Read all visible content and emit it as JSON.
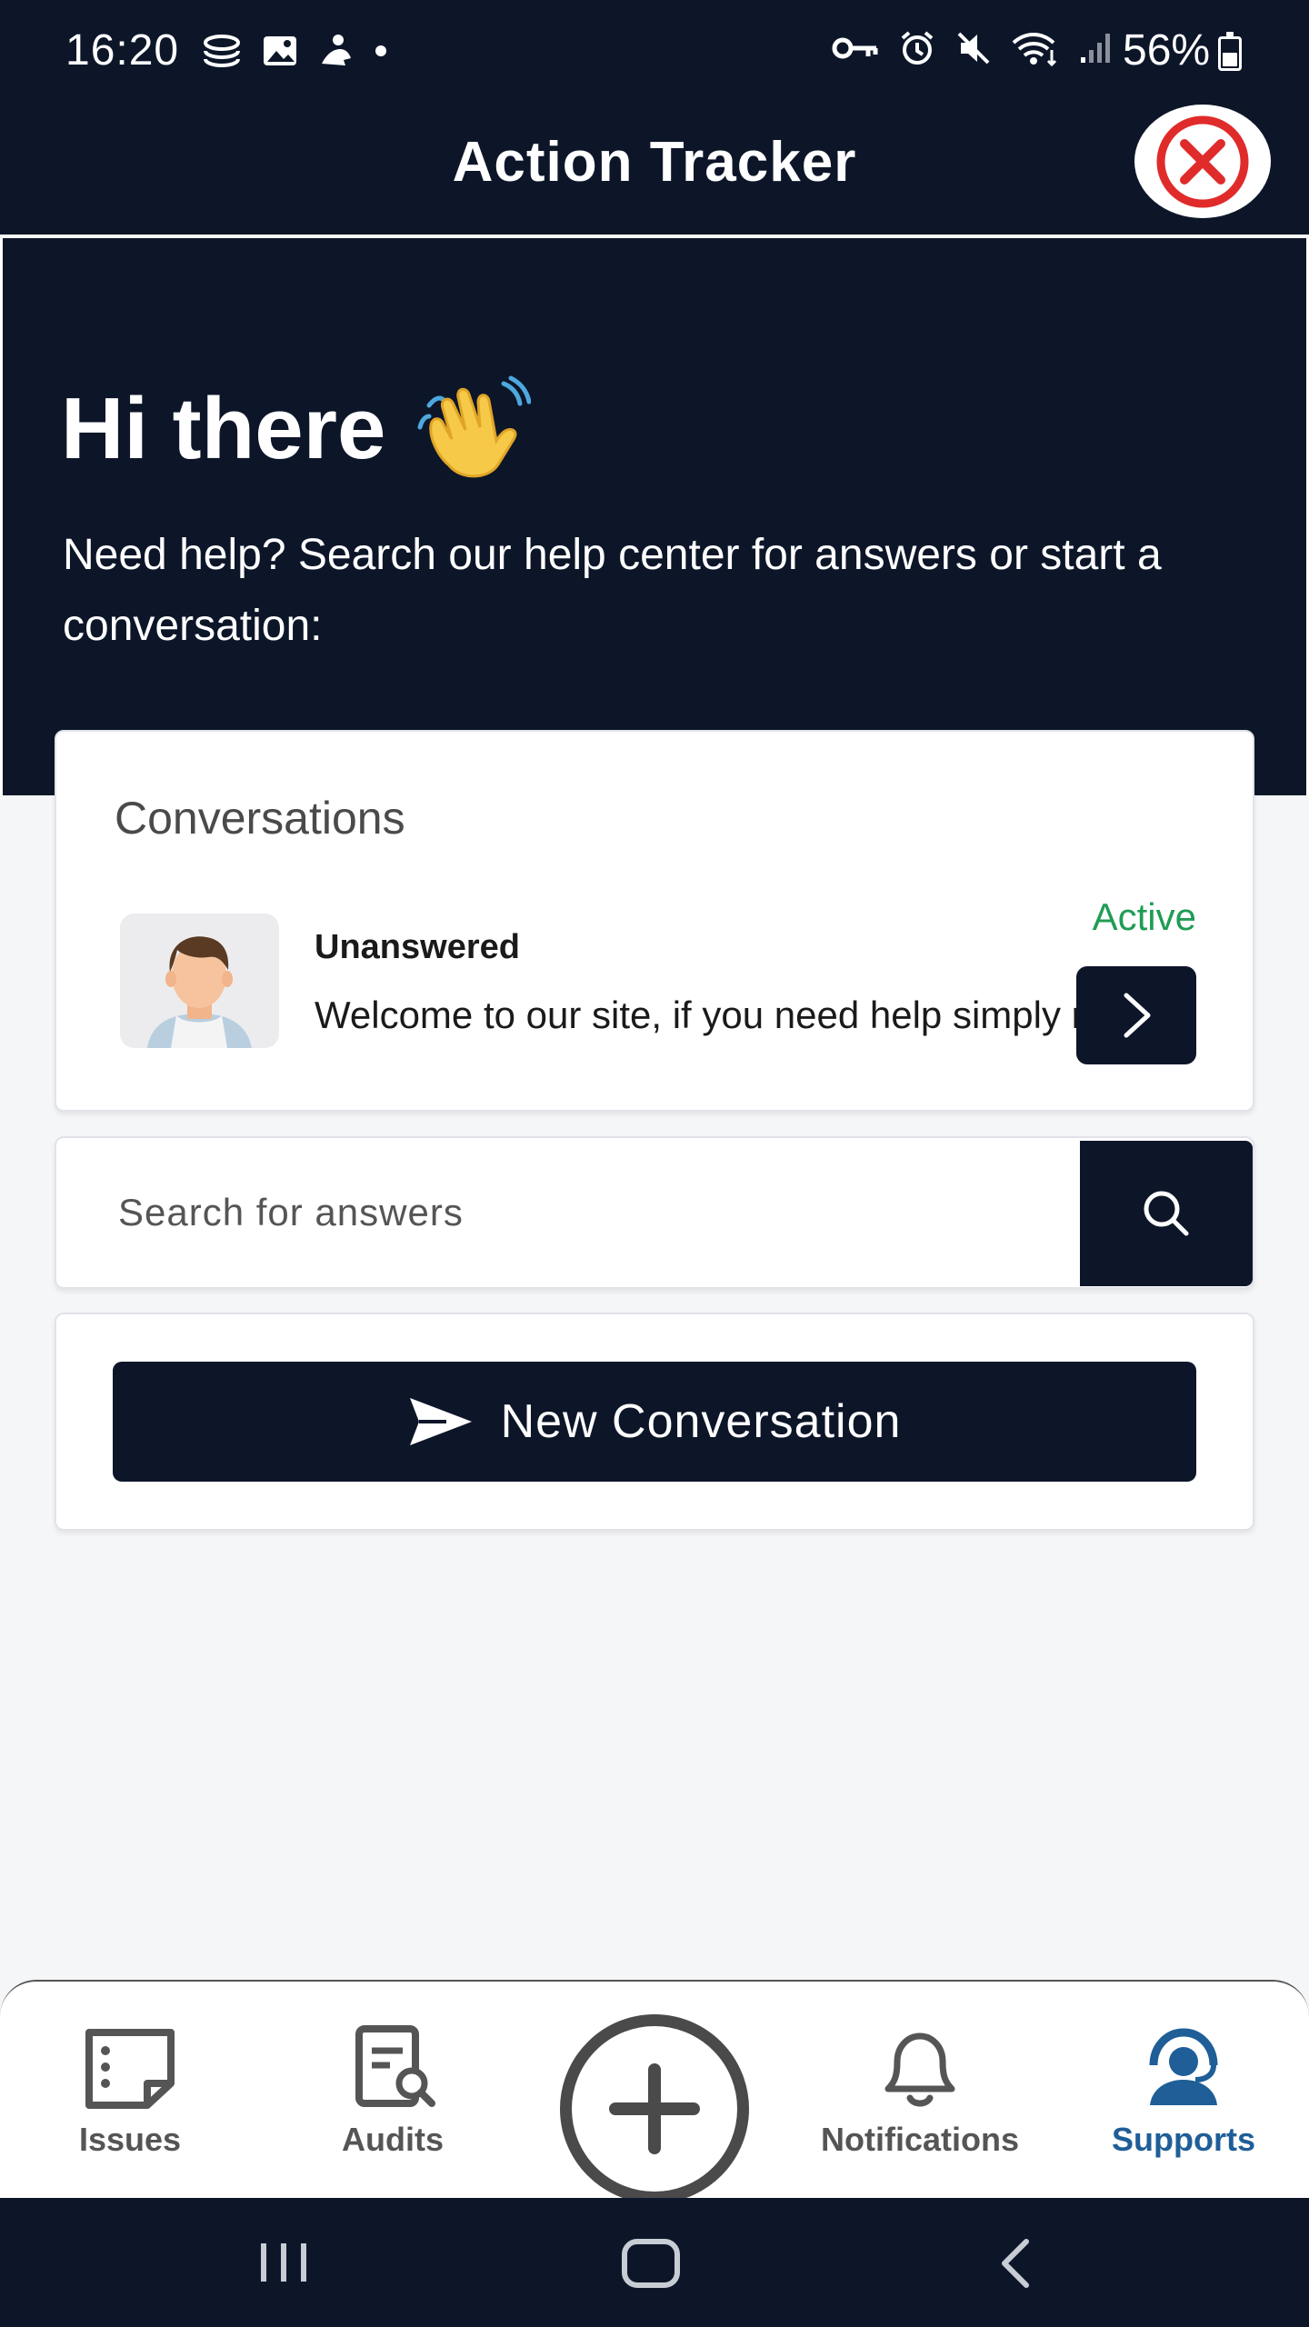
{
  "status_bar": {
    "time": "16:20",
    "battery": "56%",
    "left_icons": [
      "stack-icon",
      "image-icon",
      "person-icon",
      "dot-icon"
    ],
    "right_icons": [
      "key-icon",
      "alarm-icon",
      "mute-icon",
      "wifi-icon",
      "signal-icon"
    ]
  },
  "app": {
    "title": "Action Tracker"
  },
  "hero": {
    "greeting": "Hi there",
    "greeting_emoji": "👋",
    "subtitle": "Need help? Search our help center for answers or start a conversation:"
  },
  "conversations": {
    "title": "Conversations",
    "items": [
      {
        "name": "Unanswered",
        "message": "Welcome to our site, if you need help simply reply to this message, we are online and ready to help.",
        "status": "Active"
      }
    ]
  },
  "search": {
    "placeholder": "Search for answers"
  },
  "new_conversation": {
    "label": "New Conversation"
  },
  "bottom_nav": {
    "items": [
      {
        "label": "Issues",
        "icon": "issues-icon"
      },
      {
        "label": "Audits",
        "icon": "audits-icon"
      },
      {
        "label": "",
        "icon": "plus-icon"
      },
      {
        "label": "Notifications",
        "icon": "bell-icon"
      },
      {
        "label": "Supports",
        "icon": "support-icon"
      }
    ],
    "active": "Supports"
  },
  "colors": {
    "dark": "#0d1629",
    "active_green": "#1f9d55",
    "nav_active": "#1f5e97",
    "close_red": "#e02b2b"
  }
}
